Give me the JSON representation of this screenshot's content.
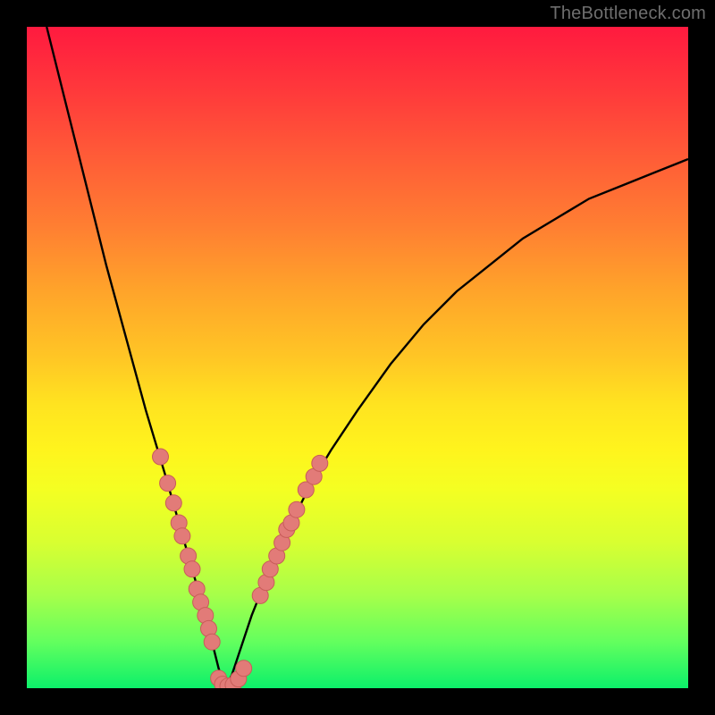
{
  "watermark": "TheBottleneck.com",
  "colors": {
    "frame": "#000000",
    "curve": "#000000",
    "marker_fill": "#e27b78",
    "marker_stroke": "#c85d59",
    "gradient_top": "#ff1a3f",
    "gradient_bottom": "#0cf06a"
  },
  "chart_data": {
    "type": "line",
    "title": "",
    "xlabel": "",
    "ylabel": "",
    "xlim": [
      0,
      100
    ],
    "ylim": [
      0,
      100
    ],
    "grid": false,
    "legend": false,
    "curve": {
      "description": "V-shaped bottleneck curve; value 0 at x≈30 (vertex), rising steeply to left and gently to right",
      "x": [
        3,
        6,
        9,
        12,
        15,
        18,
        21,
        23,
        25,
        27,
        28,
        29,
        30,
        31,
        32,
        34,
        36,
        38,
        40,
        43,
        46,
        50,
        55,
        60,
        65,
        70,
        75,
        80,
        85,
        90,
        95,
        100
      ],
      "y": [
        100,
        88,
        76,
        64,
        53,
        42,
        32,
        25,
        18,
        11,
        7,
        3,
        0,
        2,
        5,
        11,
        16,
        21,
        25,
        31,
        36,
        42,
        49,
        55,
        60,
        64,
        68,
        71,
        74,
        76,
        78,
        80
      ]
    },
    "series": [
      {
        "name": "left-arm-markers",
        "x": [
          20.2,
          21.3,
          22.2,
          23.0,
          23.5,
          24.4,
          25.0,
          25.7,
          26.3,
          27.0,
          27.5,
          28.0
        ],
        "y": [
          35,
          31,
          28,
          25,
          23,
          20,
          18,
          15,
          13,
          11,
          9,
          7
        ]
      },
      {
        "name": "bottom-markers",
        "x": [
          29.0,
          29.6,
          30.4,
          31.2,
          32.0,
          32.8
        ],
        "y": [
          1.5,
          0.6,
          0.3,
          0.5,
          1.4,
          3.0
        ]
      },
      {
        "name": "right-arm-markers",
        "x": [
          35.3,
          36.2,
          36.8,
          37.8,
          38.6,
          39.3,
          40.0,
          40.8,
          42.2,
          43.4,
          44.3
        ],
        "y": [
          14,
          16,
          18,
          20,
          22,
          24,
          25,
          27,
          30,
          32,
          34
        ]
      }
    ]
  }
}
